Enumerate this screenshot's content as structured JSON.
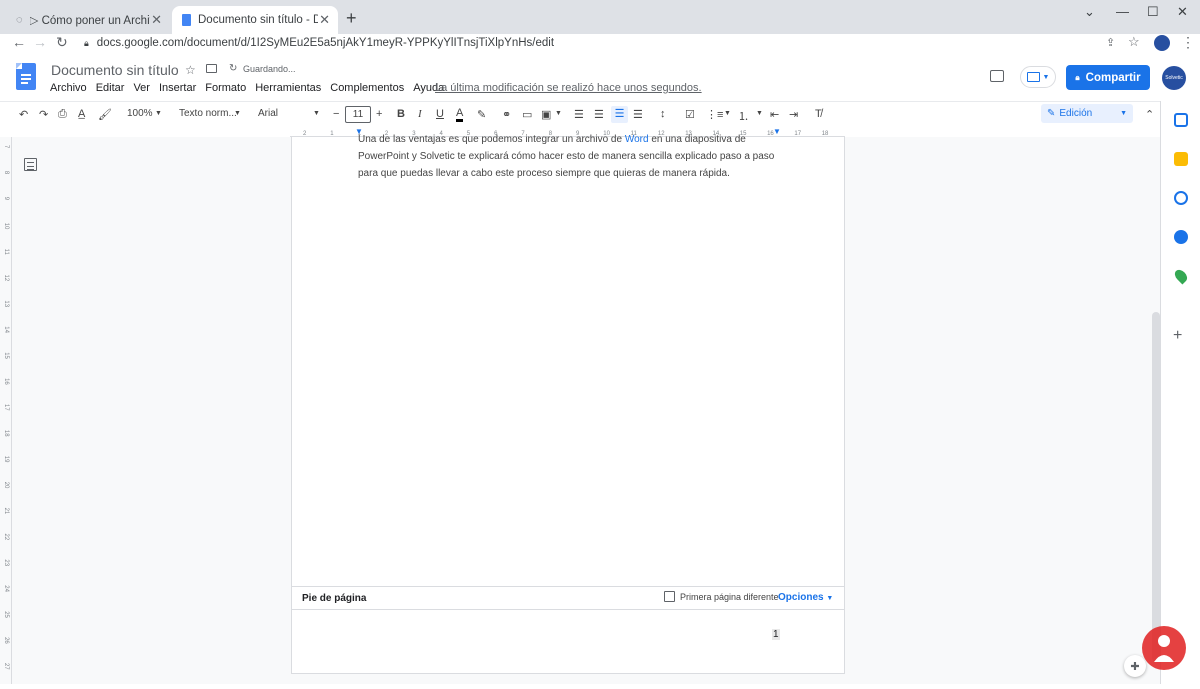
{
  "browser": {
    "tabs": [
      {
        "title": "▷ Cómo poner un Archivo de Wo"
      },
      {
        "title": "Documento sin título - Docume"
      }
    ],
    "url": "docs.google.com/document/d/1I2SyMEu2E5a5njAkY1meyR-YPPKyYlITnsjTiXlpYnHs/edit"
  },
  "docs": {
    "title": "Documento sin título",
    "saving": "Guardando...",
    "menu": [
      "Archivo",
      "Editar",
      "Ver",
      "Insertar",
      "Formato",
      "Herramientas",
      "Complementos",
      "Ayuda"
    ],
    "last_modified": "La última modificación se realizó hace unos segundos.",
    "share_label": "Compartir",
    "avatar_text": "Solvetic"
  },
  "toolbar": {
    "zoom": "100%",
    "style": "Texto norm...",
    "font": "Arial",
    "font_size": "11",
    "edit_mode": "Edición"
  },
  "ruler": {
    "h_ticks": [
      "2",
      "1",
      "1",
      "2",
      "3",
      "4",
      "5",
      "6",
      "7",
      "8",
      "9",
      "10",
      "11",
      "12",
      "13",
      "14",
      "15",
      "16",
      "17",
      "18"
    ],
    "v_ticks": [
      "7",
      "8",
      "9",
      "10",
      "11",
      "12",
      "13",
      "14",
      "15",
      "16",
      "17",
      "18",
      "19",
      "20",
      "21",
      "22",
      "23",
      "24",
      "25",
      "26",
      "27"
    ]
  },
  "document": {
    "line1_before": "Una de las ventajas es que podemos integrar un archivo de ",
    "line1_link": "Word",
    "line1_after": " en una diapositiva de",
    "line2": "PowerPoint y Solvetic te explicará cómo hacer esto de manera sencilla explicado paso a paso",
    "line3": "para que puedas llevar a cabo este proceso siempre que quieras de manera rápida."
  },
  "footer": {
    "label": "Pie de página",
    "first_page_diff": "Primera página diferente",
    "options": "Opciones",
    "page_number": "1"
  },
  "colors": {
    "accent": "#1a73e8",
    "docs_blue": "#4285f4"
  }
}
